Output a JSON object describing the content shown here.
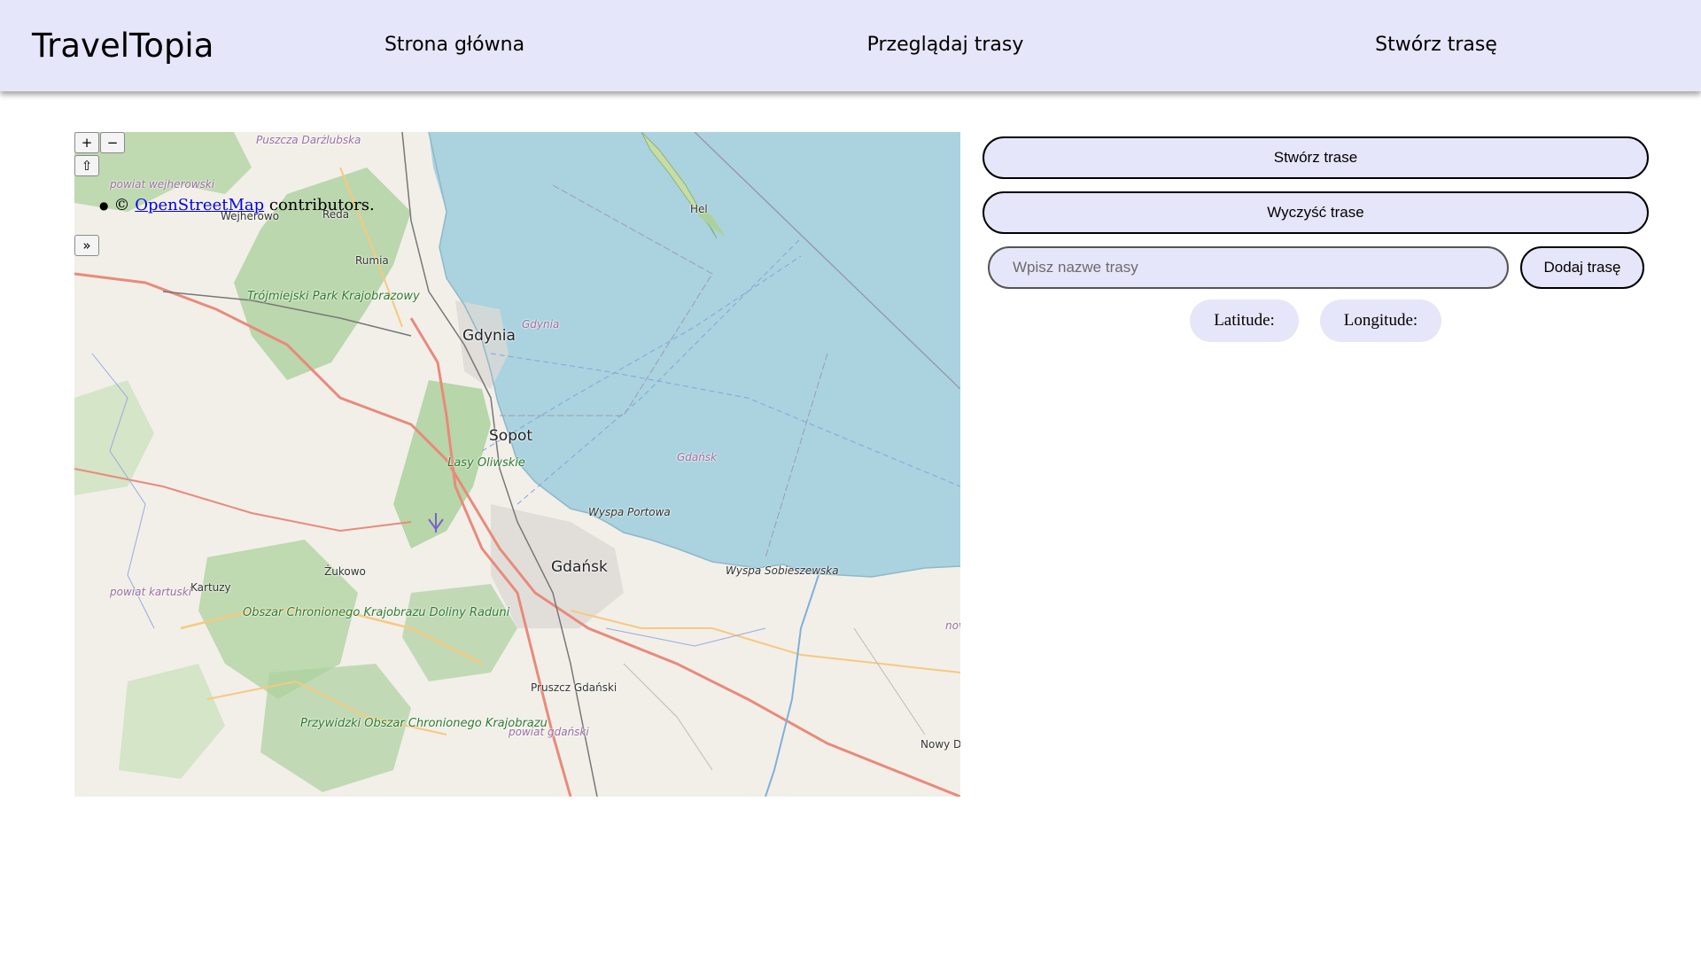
{
  "navbar": {
    "brand": "TravelTopia",
    "links": {
      "home": "Strona główna",
      "browse": "Przeglądaj trasy",
      "create": "Stwórz trasę"
    }
  },
  "map": {
    "controls": {
      "zoom_in": "+",
      "zoom_out": "−",
      "rotate": "⇧",
      "expand": "»"
    },
    "attribution": {
      "prefix": "©",
      "link": "OpenStreetMap",
      "suffix": "contributors."
    },
    "labels": {
      "puszcza": "Puszcza Darżlubska",
      "powiat_wej": "powiat wejherowski",
      "wejherowo": "Wejherowo",
      "reda": "Reda",
      "rumia": "Rumia",
      "hel": "Hel",
      "tpk": "Trójmiejski Park Krajobrazowy",
      "gdynia": "Gdynia",
      "gdynia_sea": "Gdynia",
      "sopot": "Sopot",
      "lasy": "Lasy Oliwskie",
      "gdansk_sea": "Gdańsk",
      "wyspa_portowa": "Wyspa Portowa",
      "gdansk": "Gdańsk",
      "wyspa_sob": "Wyspa Sobieszewska",
      "zukowo": "Żukowo",
      "kartuzy": "Kartuzy",
      "powiat_kart": "powiat kartuski",
      "obszar": "Obszar Chronionego Krajobrazu Doliny Raduni",
      "pruszcz": "Pruszcz Gdański",
      "przywidzki": "Przywidzki Obszar Chronionego Krajobrazu",
      "powiat_gd": "powiat gdański",
      "nowy_dwor": "Nowy Dwór Gdański",
      "now_edge": "nov"
    }
  },
  "panel": {
    "create_route": "Stwórz trase",
    "clear_route": "Wyczyść trase",
    "route_name_placeholder": "Wpisz nazwe trasy",
    "add_route": "Dodaj trasę",
    "latitude_label": "Latitude:",
    "longitude_label": "Longitude:"
  },
  "colors": {
    "accent": "#e6e6fa",
    "sea": "#aad3df",
    "forest": "#add19e",
    "land": "#f2efe9",
    "road_primary": "#e98a7b",
    "road_secondary": "#f7c97e"
  }
}
